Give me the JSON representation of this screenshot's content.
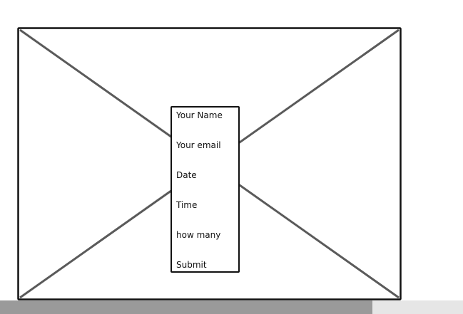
{
  "form": {
    "fields": [
      {
        "label": "Your Name"
      },
      {
        "label": "Your email"
      },
      {
        "label": "Date"
      },
      {
        "label": "Time"
      },
      {
        "label": "how many"
      }
    ],
    "submit_label": "Submit"
  },
  "scrollbar": {
    "thumb_fraction": 0.805
  },
  "colors": {
    "frame": "#111111",
    "cross_lines": "#5a5a5a",
    "scrollbar_track": "#e6e6e6",
    "scrollbar_thumb": "#9a9a9a"
  }
}
